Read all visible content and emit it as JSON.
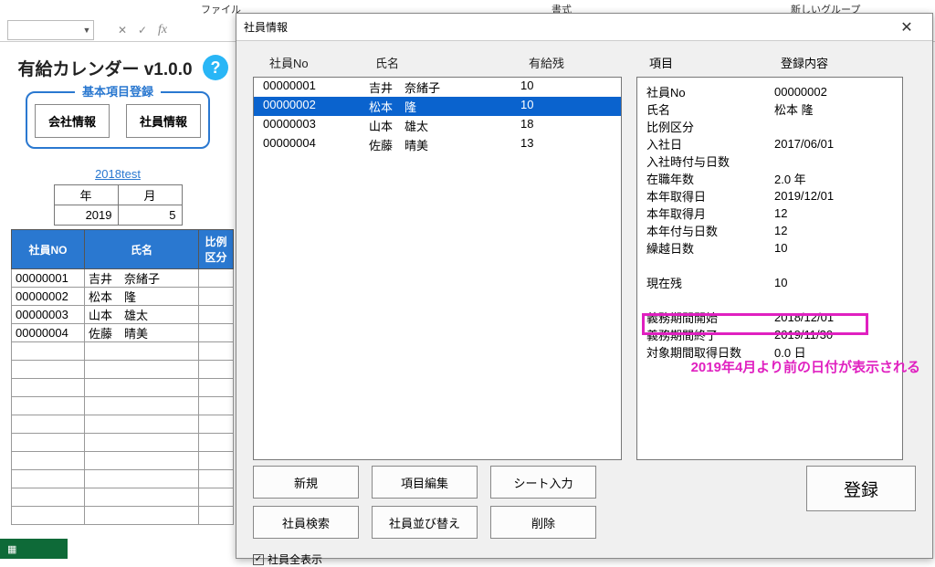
{
  "ribbon": {
    "file": "ファイル",
    "format": "書式",
    "newgroup": "新しいグループ"
  },
  "formula": {
    "fx": "fx",
    "x": "✕",
    "check": "✓"
  },
  "app": {
    "title": "有給カレンダー v1.0.0",
    "help": "?"
  },
  "regbox": {
    "legend": "基本項目登録",
    "company": "会社情報",
    "employee": "社員情報"
  },
  "dbname": "2018test",
  "ym": {
    "year_h": "年",
    "month_h": "月",
    "year": "2019",
    "month": "5"
  },
  "left_table": {
    "headers": {
      "no": "社員NO",
      "name": "氏名",
      "ratio": "比例\n区分"
    },
    "rows": [
      {
        "no": "00000001",
        "name": "吉井　奈緒子"
      },
      {
        "no": "00000002",
        "name": "松本　隆"
      },
      {
        "no": "00000003",
        "name": "山本　雄太"
      },
      {
        "no": "00000004",
        "name": "佐藤　晴美"
      }
    ]
  },
  "dialog": {
    "title": "社員情報",
    "list_headers": {
      "no": "社員No",
      "name": "氏名",
      "remain": "有給残"
    },
    "rows": [
      {
        "no": "00000001",
        "name": "吉井　奈緒子",
        "remain": "10",
        "selected": false
      },
      {
        "no": "00000002",
        "name": "松本　隆",
        "remain": "10",
        "selected": true
      },
      {
        "no": "00000003",
        "name": "山本　雄太",
        "remain": "18",
        "selected": false
      },
      {
        "no": "00000004",
        "name": "佐藤　晴美",
        "remain": "13",
        "selected": false
      }
    ],
    "detail_headers": {
      "k": "項目",
      "v": "登録内容"
    },
    "details": [
      {
        "k": "社員No",
        "v": "00000002"
      },
      {
        "k": "氏名",
        "v": "松本 隆"
      },
      {
        "k": "比例区分",
        "v": ""
      },
      {
        "k": "入社日",
        "v": "2017/06/01"
      },
      {
        "k": "入社時付与日数",
        "v": ""
      },
      {
        "k": "在職年数",
        "v": "2.0 年"
      },
      {
        "k": "本年取得日",
        "v": "2019/12/01"
      },
      {
        "k": "本年取得月",
        "v": "12"
      },
      {
        "k": "本年付与日数",
        "v": "12"
      },
      {
        "k": "繰越日数",
        "v": "10"
      },
      {
        "k": "",
        "v": ""
      },
      {
        "k": "現在残",
        "v": "10"
      },
      {
        "k": "",
        "v": ""
      },
      {
        "k": "義務期間開始",
        "v": "2018/12/01"
      },
      {
        "k": "義務期間終了",
        "v": "2019/11/30"
      },
      {
        "k": "対象期間取得日数",
        "v": "0.0 日"
      }
    ],
    "buttons": {
      "new": "新規",
      "edit": "項目編集",
      "sheet": "シート入力",
      "search": "社員検索",
      "sort": "社員並び替え",
      "delete": "削除",
      "register": "登録"
    },
    "checkbox": {
      "label": "社員全表示",
      "checked": true
    }
  },
  "annotation": "2019年4月より前の日付が表示される"
}
